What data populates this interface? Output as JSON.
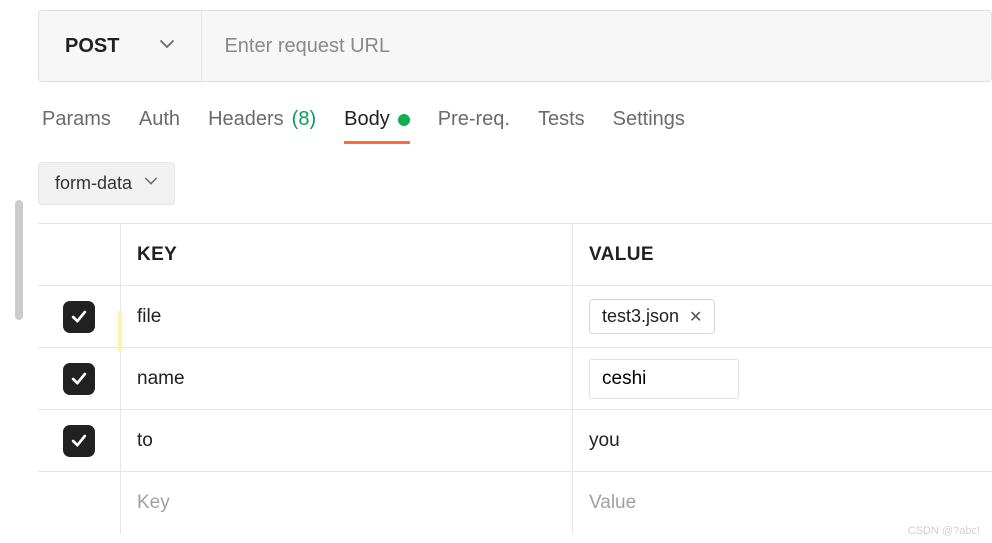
{
  "method": {
    "label": "POST"
  },
  "url": {
    "placeholder": "Enter request URL",
    "value": ""
  },
  "tabs": {
    "params": "Params",
    "auth": "Auth",
    "headers": {
      "label": "Headers",
      "count": "(8)"
    },
    "body": "Body",
    "prereq": "Pre-req.",
    "tests": "Tests",
    "settings": "Settings"
  },
  "bodyType": {
    "label": "form-data"
  },
  "table": {
    "headers": {
      "key": "KEY",
      "value": "VALUE"
    },
    "rows": [
      {
        "checked": true,
        "key": "file",
        "valueType": "file",
        "value": "test3.json"
      },
      {
        "checked": true,
        "key": "name",
        "valueType": "input",
        "value": "ceshi"
      },
      {
        "checked": true,
        "key": "to",
        "valueType": "text",
        "value": "you"
      }
    ],
    "placeholder": {
      "key": "Key",
      "value": "Value"
    }
  },
  "watermark": "CSDN @?abc!"
}
